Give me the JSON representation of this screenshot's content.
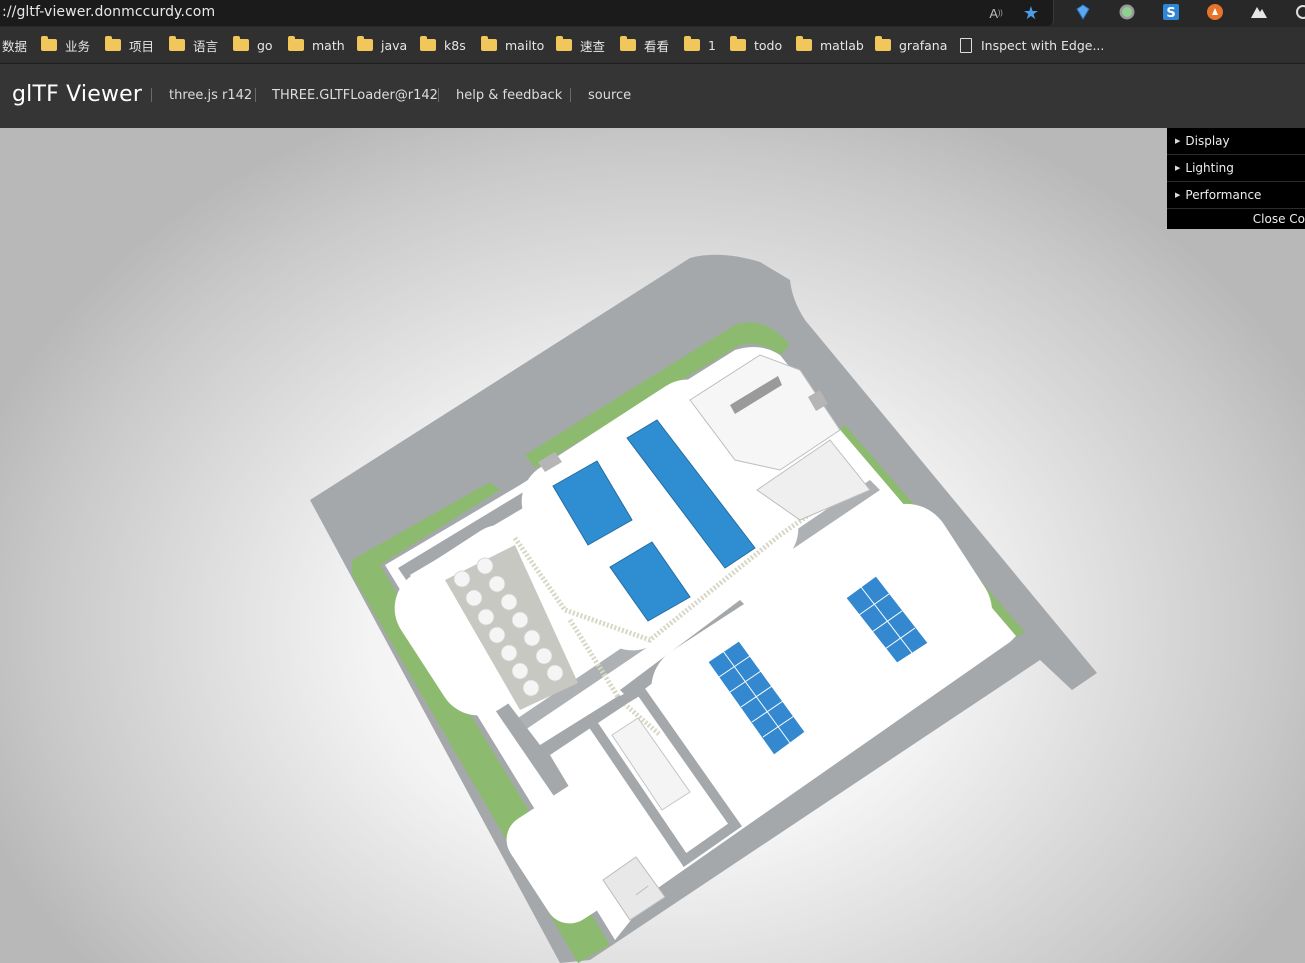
{
  "browser": {
    "url": "://gltf-viewer.donmccurdy.com",
    "read_aloud_icon": "read-aloud-icon",
    "favorite_icon": "star-icon",
    "extensions": [
      "gem-icon",
      "circle-extension-icon",
      "s-extension-icon",
      "compass-extension-icon",
      "mountain-extension-icon",
      "puzzle-icon"
    ]
  },
  "bookmarks": [
    {
      "label": "数据",
      "type": "text"
    },
    {
      "label": "业务",
      "type": "folder"
    },
    {
      "label": "项目",
      "type": "folder"
    },
    {
      "label": "语言",
      "type": "folder"
    },
    {
      "label": "go",
      "type": "folder"
    },
    {
      "label": "math",
      "type": "folder"
    },
    {
      "label": "java",
      "type": "folder"
    },
    {
      "label": "k8s",
      "type": "folder"
    },
    {
      "label": "mailto",
      "type": "folder"
    },
    {
      "label": "速查",
      "type": "folder"
    },
    {
      "label": "看看",
      "type": "folder"
    },
    {
      "label": "1",
      "type": "folder"
    },
    {
      "label": "todo",
      "type": "folder"
    },
    {
      "label": "matlab",
      "type": "folder"
    },
    {
      "label": "grafana",
      "type": "folder"
    },
    {
      "label": "Inspect with Edge...",
      "type": "page"
    }
  ],
  "header": {
    "title": "glTF Viewer",
    "links": [
      "three.js r142",
      "THREE.GLTFLoader@r142",
      "help & feedback",
      "source"
    ]
  },
  "gui": {
    "folders": [
      "Display",
      "Lighting",
      "Performance"
    ],
    "close_label": "Close Co"
  },
  "colors": {
    "road": "#a4a8ab",
    "grass": "#8cba6e",
    "pad": "#ffffff",
    "roof_blue": "#2f8ed1",
    "gravel": "#c8c8c2"
  }
}
